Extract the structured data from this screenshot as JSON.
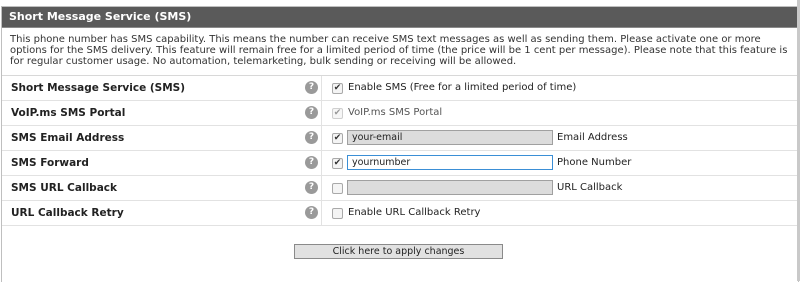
{
  "section": {
    "title": "Short Message Service (SMS)",
    "description": "This phone number has SMS capability. This means the number can receive SMS text messages as well as sending them. Please activate one or more options for the SMS delivery. This feature will remain free for a limited period of time (the price will be 1 cent per message). Please note that this feature is for regular customer usage. No automation, telemarketing, bulk sending or receiving will be allowed."
  },
  "help_glyph": "?",
  "check_glyph": "✔",
  "rows": {
    "sms": {
      "label": "Short Message Service (SMS)",
      "checked": true,
      "text": "Enable SMS (Free for a limited period of time)"
    },
    "portal": {
      "label": "VoIP.ms SMS Portal",
      "checked": true,
      "disabled": true,
      "text": "VoIP.ms SMS Portal"
    },
    "email": {
      "label": "SMS Email Address",
      "checked": true,
      "value": "your-email",
      "after": "Email Address"
    },
    "forward": {
      "label": "SMS Forward",
      "checked": true,
      "value": "yournumber",
      "after": "Phone Number"
    },
    "url": {
      "label": "SMS URL Callback",
      "checked": false,
      "value": "",
      "after": "URL Callback"
    },
    "retry": {
      "label": "URL Callback Retry",
      "checked": false,
      "text": "Enable URL Callback Retry"
    }
  },
  "apply_label": "Click here to apply changes",
  "icons": {
    "help": "help-circle-icon",
    "check": "checkmark-icon"
  }
}
